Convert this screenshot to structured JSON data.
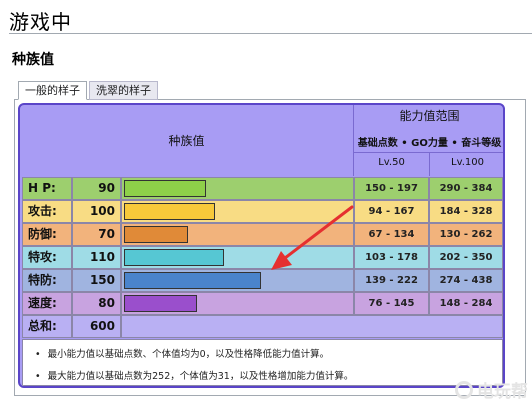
{
  "section_title": "游戏中",
  "sub_title": "种族值",
  "tabs": [
    {
      "label": "一般的样子",
      "active": true
    },
    {
      "label": "洗翠的样子",
      "active": false
    }
  ],
  "table": {
    "header_stat": "种族值",
    "header_range": "能力值范围",
    "header_range_sub": "基础点数 • GO力量 • 奋斗等级",
    "lv50": "Lv.50",
    "lv100": "Lv.100",
    "rows": [
      {
        "name": "H P:",
        "value": "90",
        "range50": "150 - 197",
        "range100": "290 - 384",
        "row_color": "#9dcf6e",
        "bar_color": "#8ed049",
        "bar_fraction": 0.36
      },
      {
        "name": "攻击:",
        "value": "100",
        "range50": "94 - 167",
        "range100": "184 - 328",
        "row_color": "#f8dc84",
        "bar_color": "#f7c93a",
        "bar_fraction": 0.4
      },
      {
        "name": "防御:",
        "value": "70",
        "range50": "67 - 134",
        "range100": "130 - 262",
        "row_color": "#f2b37c",
        "bar_color": "#e08a38",
        "bar_fraction": 0.28
      },
      {
        "name": "特攻:",
        "value": "110",
        "range50": "103 - 178",
        "range100": "202 - 350",
        "row_color": "#9fdce6",
        "bar_color": "#56c7d3",
        "bar_fraction": 0.44
      },
      {
        "name": "特防:",
        "value": "150",
        "range50": "139 - 222",
        "range100": "274 - 438",
        "row_color": "#a0b4e0",
        "bar_color": "#4a84cc",
        "bar_fraction": 0.6
      },
      {
        "name": "速度:",
        "value": "80",
        "range50": "76 - 145",
        "range100": "148 - 284",
        "row_color": "#c8a3e0",
        "bar_color": "#9a4fcc",
        "bar_fraction": 0.32
      }
    ],
    "total_label": "总和:",
    "total_value": "600",
    "notes": [
      "最小能力值以基础点数、个体值均为0，以及性格降低能力值计算。",
      "最大能力值以基础点数为252，个体值为31，以及性格增加能力值计算。"
    ]
  },
  "watermark": "电玩帮"
}
